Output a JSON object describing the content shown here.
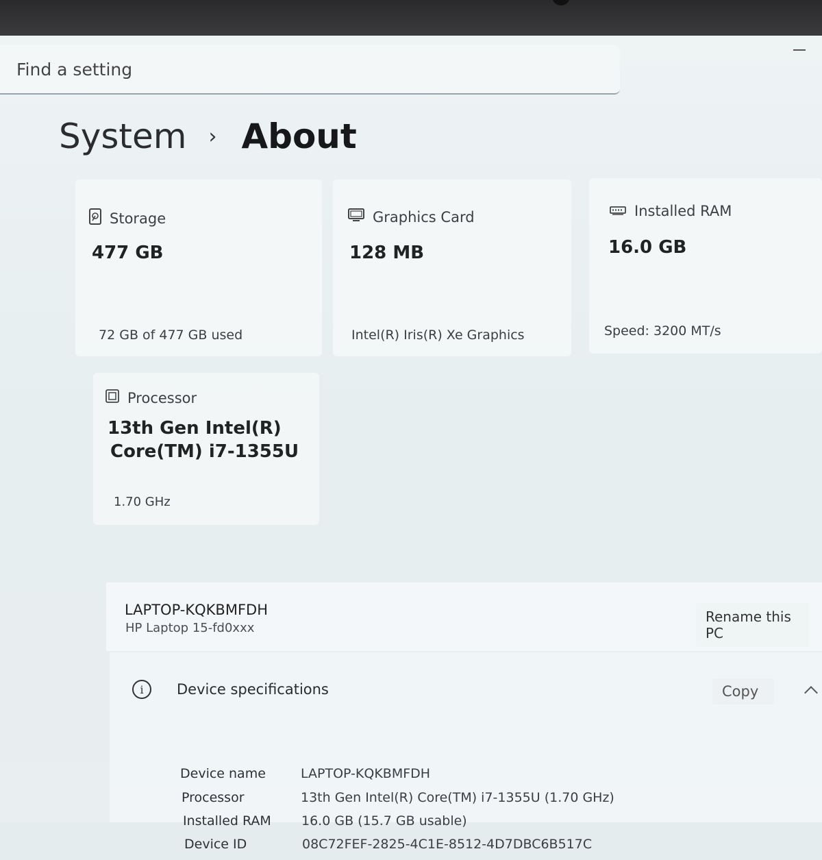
{
  "search": {
    "placeholder": "Find a setting"
  },
  "breadcrumb": {
    "parent": "System",
    "separator": "›",
    "current": "About"
  },
  "cards": {
    "storage": {
      "title": "Storage",
      "value": "477 GB",
      "sub": "72 GB of 477 GB used",
      "icon": "storage-icon"
    },
    "graphics": {
      "title": "Graphics Card",
      "value": "128 MB",
      "sub": "Intel(R) Iris(R) Xe Graphics",
      "icon": "monitor-icon"
    },
    "ram": {
      "title": "Installed RAM",
      "value": "16.0 GB",
      "sub": "Speed: 3200 MT/s",
      "icon": "memory-icon"
    },
    "processor": {
      "title": "Processor",
      "value_line1": "13th Gen Intel(R)",
      "value_line2": "Core(TM) i7-1355U",
      "sub": "1.70 GHz",
      "icon": "chip-icon"
    }
  },
  "pc": {
    "name": "LAPTOP-KQKBMFDH",
    "model": "HP Laptop 15-fd0xxx",
    "rename_label": "Rename this PC"
  },
  "device_specs": {
    "title": "Device specifications",
    "copy_label": "Copy",
    "rows": [
      {
        "label": "Device name",
        "value": "LAPTOP-KQKBMFDH"
      },
      {
        "label": "Processor",
        "value": "13th Gen Intel(R) Core(TM) i7-1355U (1.70 GHz)"
      },
      {
        "label": "Installed RAM",
        "value": "16.0 GB (15.7 GB usable)"
      },
      {
        "label": "Device ID",
        "value": "08C72FEF-2825-4C1E-8512-4D7DBC6B517C"
      }
    ]
  }
}
